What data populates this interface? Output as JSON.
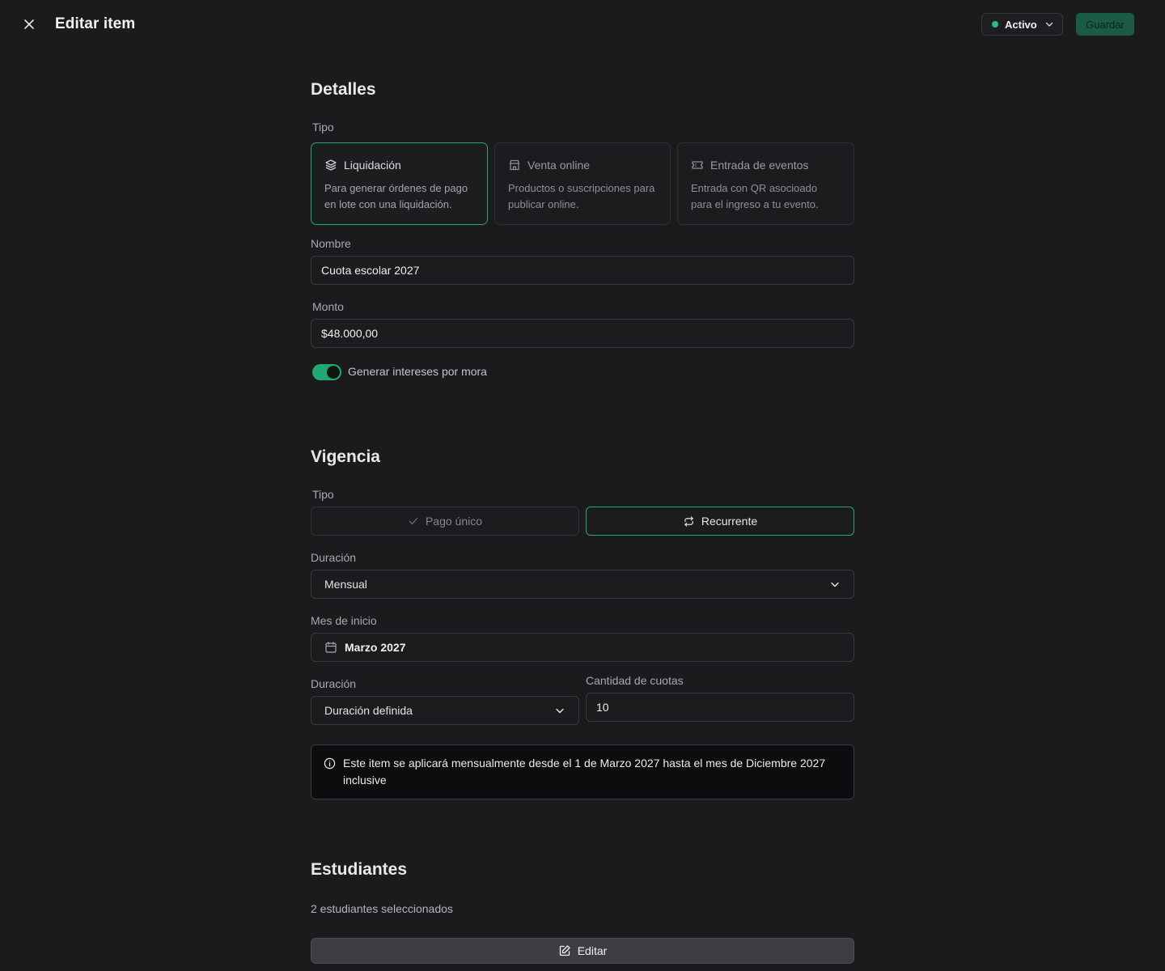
{
  "header": {
    "title": "Editar item",
    "status_label": "Activo",
    "save_label": "Guardar"
  },
  "details": {
    "title": "Detalles",
    "type_label": "Tipo",
    "types": [
      {
        "title": "Liquidación",
        "description": "Para generar órdenes de pago en lote con una liquidación.",
        "icon": "layers-icon",
        "selected": true
      },
      {
        "title": "Venta online",
        "description": "Productos o suscripciones para publicar online.",
        "icon": "store-icon",
        "selected": false
      },
      {
        "title": "Entrada de eventos",
        "description": "Entrada con QR asocioado para el ingreso a tu evento.",
        "icon": "ticket-icon",
        "selected": false
      }
    ],
    "name_label": "Nombre",
    "name_value": "Cuota escolar 2027",
    "amount_label": "Monto",
    "amount_value": "$48.000,00",
    "interest_toggle_label": "Generar intereses por mora",
    "interest_toggle_on": true
  },
  "validity": {
    "title": "Vigencia",
    "type_label": "Tipo",
    "options": [
      {
        "label": "Pago único",
        "selected": false
      },
      {
        "label": "Recurrente",
        "selected": true
      }
    ],
    "frequency_label": "Duración",
    "frequency_value": "Mensual",
    "start_month_label": "Mes de inicio",
    "start_month_value": "Marzo 2027",
    "duration_label": "Duración",
    "duration_value": "Duración definida",
    "installments_label": "Cantidad de cuotas",
    "installments_value": "10",
    "info_text": "Este item se aplicará mensualmente desde el 1 de Marzo 2027 hasta el mes de Diciembre 2027 inclusive"
  },
  "students": {
    "title": "Estudiantes",
    "count_text": "2 estudiantes seleccionados",
    "edit_label": "Editar"
  },
  "colors": {
    "background": "#1b1b1d",
    "accent": "#21a874",
    "status_active": "#22c07a",
    "save_button": "#1a5c43"
  }
}
